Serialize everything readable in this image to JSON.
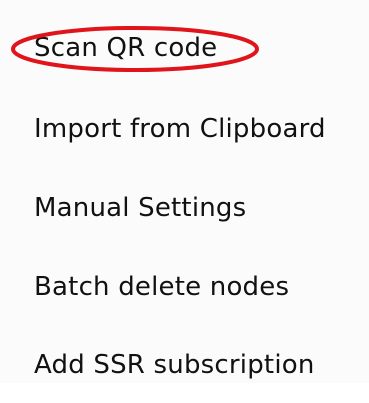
{
  "menu": {
    "items": [
      {
        "label": "Scan QR code"
      },
      {
        "label": "Import from Clipboard"
      },
      {
        "label": "Manual Settings"
      },
      {
        "label": "Batch delete nodes"
      },
      {
        "label": "Add SSR subscription"
      }
    ]
  },
  "highlight": {
    "target": "Scan QR code",
    "color": "#e0151c"
  }
}
